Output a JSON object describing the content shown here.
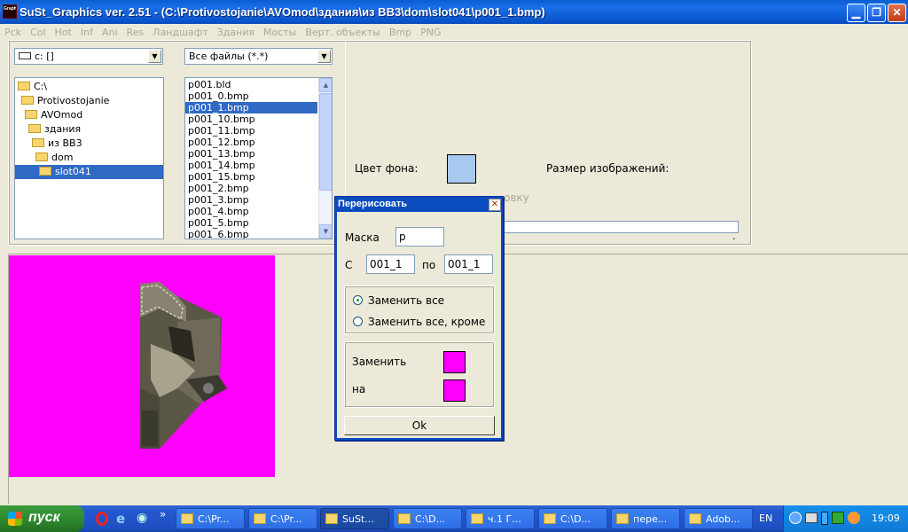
{
  "window": {
    "title": "SuSt_Graphics ver. 2.51     -     (C:\\Protivostojanie\\AVOmod\\здания\\из BB3\\dom\\slot041\\p001_1.bmp)",
    "icon_label": "Graph",
    "minimize_icon": "minimize-icon",
    "maximize_icon": "restore-icon",
    "close_icon": "close-icon"
  },
  "menu": [
    "Pck",
    "Col",
    "Hot",
    "Inf",
    "Ani",
    "Res",
    "Ландшафт",
    "Здания",
    "Мосты",
    "Верт. объекты",
    "Bmp",
    "PNG"
  ],
  "drive_combo": {
    "value": "c: []"
  },
  "filter_combo": {
    "value": "Все файлы (*.*)"
  },
  "folders": [
    {
      "label": "C:\\",
      "indent": 0
    },
    {
      "label": "Protivostojanie",
      "indent": 1
    },
    {
      "label": "AVOmod",
      "indent": 2
    },
    {
      "label": "здания",
      "indent": 3
    },
    {
      "label": "из BB3",
      "indent": 4
    },
    {
      "label": "dom",
      "indent": 5
    },
    {
      "label": "slot041",
      "indent": 6,
      "selected": true
    }
  ],
  "files": [
    "p001.bld",
    "p001_0.bmp",
    "p001_1.bmp",
    "p001_10.bmp",
    "p001_11.bmp",
    "p001_12.bmp",
    "p001_13.bmp",
    "p001_14.bmp",
    "p001_15.bmp",
    "p001_2.bmp",
    "p001_3.bmp",
    "p001_4.bmp",
    "p001_5.bmp",
    "p001_6.bmp"
  ],
  "selected_file_index": 2,
  "options": {
    "bg_color_label": "Цвет фона:",
    "bg_color": "#a8c8f0",
    "image_size_label": "Размер изображений:",
    "hidden_checkbox_tail": "овку",
    "progress_dot": "."
  },
  "preview": {
    "bg_color": "#ff00ff"
  },
  "dialog": {
    "title": "Перерисовать",
    "mask_label": "Маска",
    "mask_value": "p",
    "from_label": "С",
    "from_value": "001_1",
    "to_label": "по",
    "to_value": "001_1",
    "radio_replace_all": "Заменить все",
    "radio_replace_except": "Заменить все, кроме",
    "replace_label": "Заменить",
    "with_label": "на",
    "replace_color": "#ff00ff",
    "with_color": "#ff00ff",
    "ok_label": "Ok"
  },
  "taskbar": {
    "start_label": "пуск",
    "tasks": [
      "C:\\Pr...",
      "C:\\Pr...",
      "SuSt...",
      "C:\\D...",
      "ч.1 Г...",
      "C:\\D...",
      "пере...",
      "Adob..."
    ],
    "active_task_index": 2,
    "lang": "EN",
    "clock": "19:09"
  }
}
